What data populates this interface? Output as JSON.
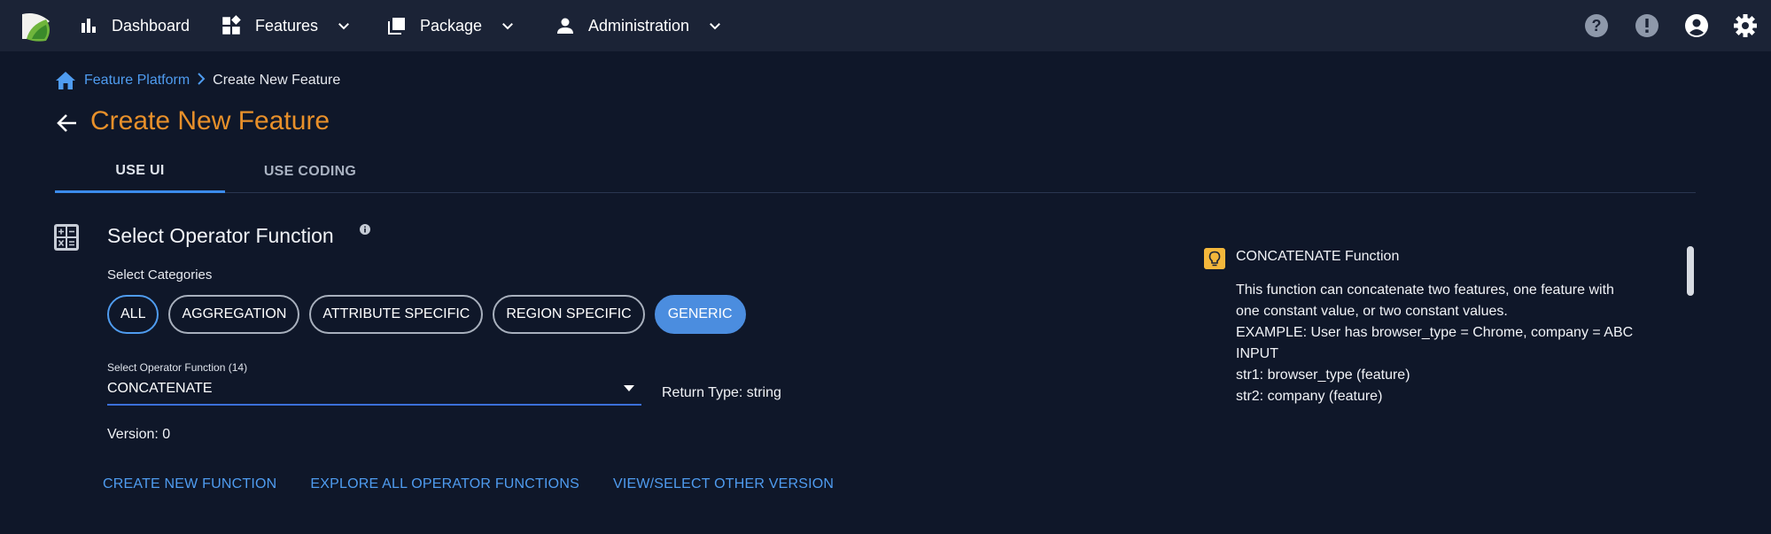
{
  "nav": {
    "items": [
      {
        "label": "Dashboard"
      },
      {
        "label": "Features"
      },
      {
        "label": "Package"
      },
      {
        "label": "Administration"
      }
    ]
  },
  "breadcrumb": {
    "parent": "Feature Platform",
    "separator": "›",
    "current": "Create New Feature"
  },
  "page": {
    "title": "Create New Feature"
  },
  "tabs": [
    {
      "label": "USE UI",
      "active": true
    },
    {
      "label": "USE CODING",
      "active": false
    }
  ],
  "section": {
    "title": "Select Operator Function",
    "categories_label": "Select Categories",
    "categories": [
      {
        "label": "ALL",
        "state": "outlined-accent"
      },
      {
        "label": "AGGREGATION",
        "state": "outlined"
      },
      {
        "label": "ATTRIBUTE SPECIFIC",
        "state": "outlined"
      },
      {
        "label": "REGION SPECIFIC",
        "state": "outlined"
      },
      {
        "label": "GENERIC",
        "state": "selected"
      }
    ],
    "select_label": "Select Operator Function (14)",
    "select_value": "CONCATENATE",
    "return_type": "Return Type: string",
    "version": "Version: 0",
    "actions": [
      {
        "label": "CREATE NEW FUNCTION"
      },
      {
        "label": "EXPLORE ALL OPERATOR FUNCTIONS"
      },
      {
        "label": "VIEW/SELECT OTHER VERSION"
      }
    ]
  },
  "help": {
    "title": "CONCATENATE Function",
    "lines": [
      "This function can concatenate two features, one feature with",
      "one constant value, or two constant values.",
      "EXAMPLE: User has browser_type = Chrome, company = ABC",
      "INPUT",
      "str1: browser_type (feature)",
      "str2: company (feature)"
    ]
  },
  "colors": {
    "background": "#0f1729",
    "topbar": "#1b2336",
    "accent_blue": "#4f9cf0",
    "title_orange": "#e8902a",
    "chip_selected": "#4b8ddf",
    "bulb_yellow": "#f3b73b"
  },
  "icons": {
    "logo": "app-logo",
    "dashboard": "bar-chart-icon",
    "features": "widgets-icon",
    "package": "library-icon",
    "administration": "person-icon",
    "help": "help-circle-icon",
    "alert": "alert-circle-icon",
    "account": "account-circle-icon",
    "settings": "gear-icon"
  }
}
